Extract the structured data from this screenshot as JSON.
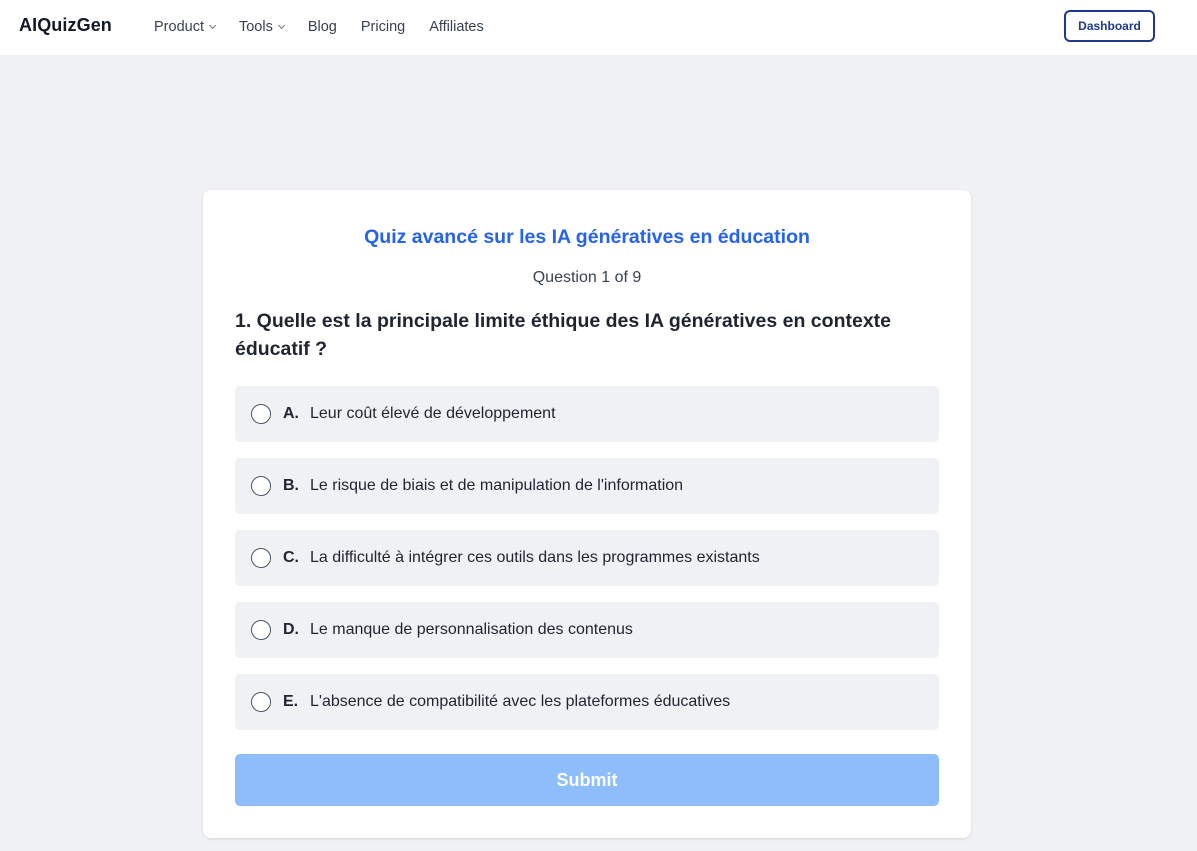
{
  "navbar": {
    "brand": "AIQuizGen",
    "links": [
      {
        "label": "Product",
        "has_dropdown": true
      },
      {
        "label": "Tools",
        "has_dropdown": true
      },
      {
        "label": "Blog",
        "has_dropdown": false
      },
      {
        "label": "Pricing",
        "has_dropdown": false
      },
      {
        "label": "Affiliates",
        "has_dropdown": false
      }
    ],
    "dashboard_label": "Dashboard"
  },
  "quiz": {
    "title": "Quiz avancé sur les IA génératives en éducation",
    "progress": "Question 1 of 9",
    "question": "1. Quelle est la principale limite éthique des IA génératives en contexte éducatif ?",
    "options": [
      {
        "letter": "A.",
        "text": "Leur coût élevé de développement"
      },
      {
        "letter": "B.",
        "text": "Le risque de biais et de manipulation de l'information"
      },
      {
        "letter": "C.",
        "text": "La difficulté à intégrer ces outils dans les programmes existants"
      },
      {
        "letter": "D.",
        "text": "Le manque de personnalisation des contenus"
      },
      {
        "letter": "E.",
        "text": "L'absence de compatibilité avec les plateformes éducatives"
      }
    ],
    "submit_label": "Submit"
  },
  "colors": {
    "accent": "#2563eb",
    "submit_disabled": "#8dbdfa",
    "background": "#f0f1f5",
    "dashboard_border": "#1e3a8a"
  }
}
